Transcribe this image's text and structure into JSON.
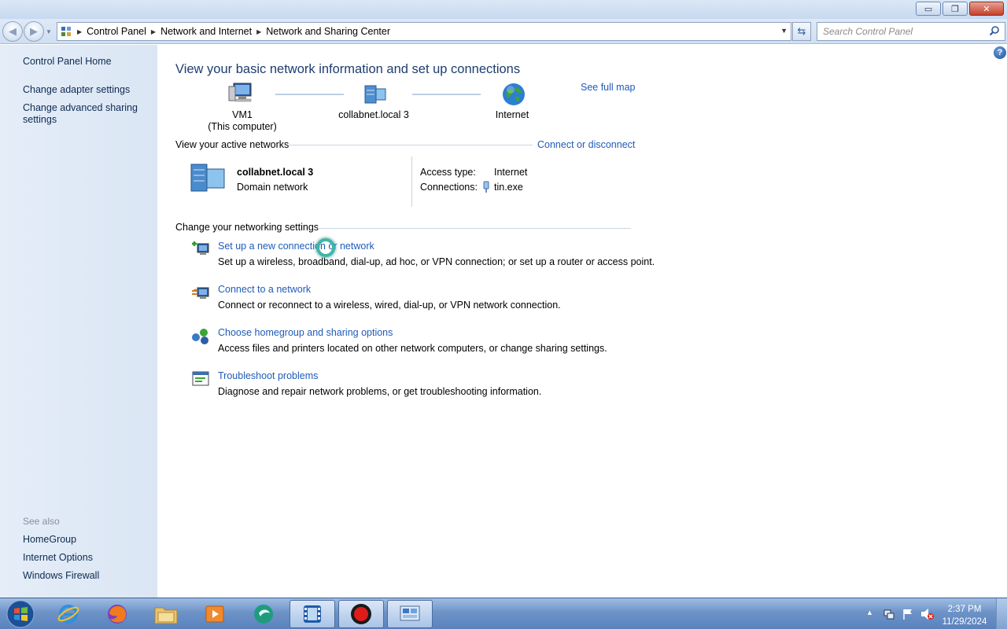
{
  "window": {
    "minimize_label": "▭",
    "maximize_label": "❐",
    "close_label": "✕"
  },
  "address": {
    "crumbs": [
      "Control Panel",
      "Network and Internet",
      "Network and Sharing Center"
    ],
    "search_placeholder": "Search Control Panel"
  },
  "sidebar": {
    "home": "Control Panel Home",
    "adapter": "Change adapter settings",
    "advanced_line1": "Change advanced sharing",
    "advanced_line2": "settings",
    "see_also": "See also",
    "see_also_items": [
      "HomeGroup",
      "Internet Options",
      "Windows Firewall"
    ]
  },
  "main": {
    "title": "View your basic network information and set up connections",
    "see_full_map": "See full map",
    "map": {
      "computer_name": "VM1",
      "computer_sub": "(This computer)",
      "network_name": "collabnet.local  3",
      "internet": "Internet"
    },
    "active_networks": {
      "header": "View your active networks",
      "connect_link": "Connect or disconnect",
      "network_name": "collabnet.local  3",
      "network_type": "Domain network",
      "access_type_label": "Access type:",
      "access_type_value": "Internet",
      "connections_label": "Connections:",
      "connections_value": "tin.exe"
    },
    "settings": {
      "header": "Change your networking settings",
      "tasks": [
        {
          "link": "Set up a new connection or network",
          "desc": "Set up a wireless, broadband, dial-up, ad hoc, or VPN connection; or set up a router or access point."
        },
        {
          "link": "Connect to a network",
          "desc": "Connect or reconnect to a wireless, wired, dial-up, or VPN network connection."
        },
        {
          "link": "Choose homegroup and sharing options",
          "desc": "Access files and printers located on other network computers, or change sharing settings."
        },
        {
          "link": "Troubleshoot problems",
          "desc": "Diagnose and repair network problems, or get troubleshooting information."
        }
      ]
    }
  },
  "taskbar": {
    "time": "2:37 PM",
    "date": "11/29/2024"
  }
}
